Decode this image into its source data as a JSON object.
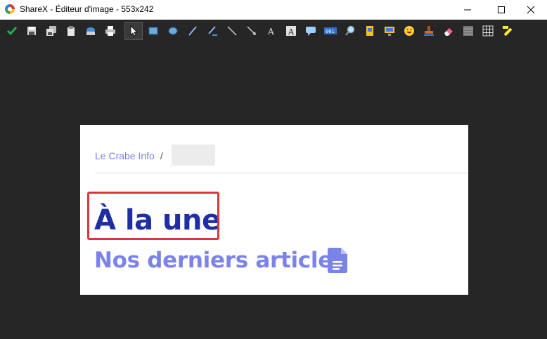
{
  "window": {
    "title": "ShareX - Éditeur d'image - 553x242",
    "controls": [
      "minimize-icon",
      "maximize-icon",
      "close-icon"
    ]
  },
  "toolbar": {
    "tools": [
      "confirm-checkmark-icon",
      "save-icon",
      "save-as-icon",
      "copy-clipboard-icon",
      "upload-icon",
      "print-icon",
      "select-pointer-icon",
      "rectangle-icon",
      "ellipse-icon",
      "freehand-pen-icon",
      "smart-eraser-pen-icon",
      "line-icon",
      "arrow-icon",
      "text-icon",
      "text-background-icon",
      "speech-balloon-icon",
      "step-number-icon",
      "magnify-icon",
      "image-file-icon",
      "image-screen-icon",
      "emoji-sticker-icon",
      "cursor-stamp-icon",
      "eraser-icon",
      "blur-icon",
      "pixelate-icon",
      "highlight-marker-icon"
    ],
    "active_tool": "select-pointer-icon",
    "step_number_label": "001"
  },
  "canvas": {
    "breadcrumb_site": "Le Crabe Info",
    "breadcrumb_separator": "/",
    "headline": "À la une",
    "subheadline": "Nos derniers articles",
    "subheadline_icon": "document-icon",
    "annotation": "red-rectangle",
    "colors": {
      "headline": "#1f2fa3",
      "subheadline": "#7b83e8",
      "annotation_border": "#d9363e",
      "editor_background": "#262626"
    }
  }
}
